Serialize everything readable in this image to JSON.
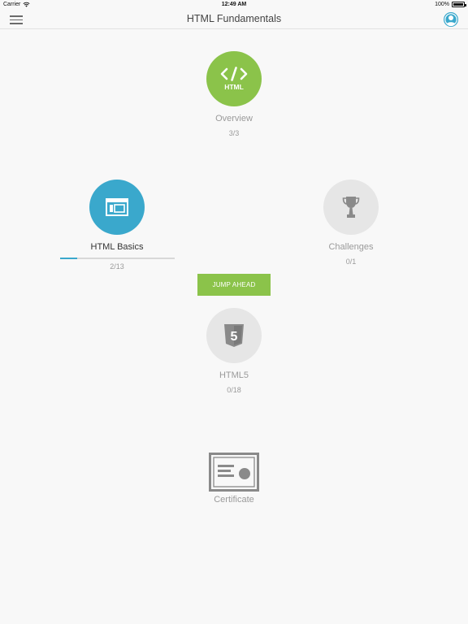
{
  "status_bar": {
    "carrier": "Carrier",
    "time": "12:49 AM",
    "battery": "100%",
    "wifi_icon": "wifi-icon",
    "battery_icon": "battery-icon"
  },
  "nav": {
    "title": "HTML Fundamentals",
    "menu_icon": "hamburger-menu-icon",
    "profile_icon": "user-profile-icon"
  },
  "colors": {
    "green": "#8bc34a",
    "blue": "#3aa8cc",
    "gray": "#e6e6e6",
    "text_gray": "#9a9a9a"
  },
  "nodes": {
    "overview": {
      "label": "Overview",
      "count": "3/3",
      "icon": "html-code-icon",
      "icon_text": "HTML",
      "state": "completed"
    },
    "basics": {
      "label": "HTML Basics",
      "count": "2/13",
      "icon": "browser-window-icon",
      "state": "in-progress",
      "progress": 0.15
    },
    "challenges": {
      "label": "Challenges",
      "count": "0/1",
      "icon": "trophy-icon",
      "state": "locked"
    },
    "html5": {
      "label": "HTML5",
      "count": "0/18",
      "icon": "html5-shield-icon",
      "icon_text": "5",
      "state": "locked"
    }
  },
  "jump_button": {
    "label": "JUMP AHEAD"
  },
  "certificate": {
    "label": "Certificate",
    "icon": "certificate-icon"
  }
}
